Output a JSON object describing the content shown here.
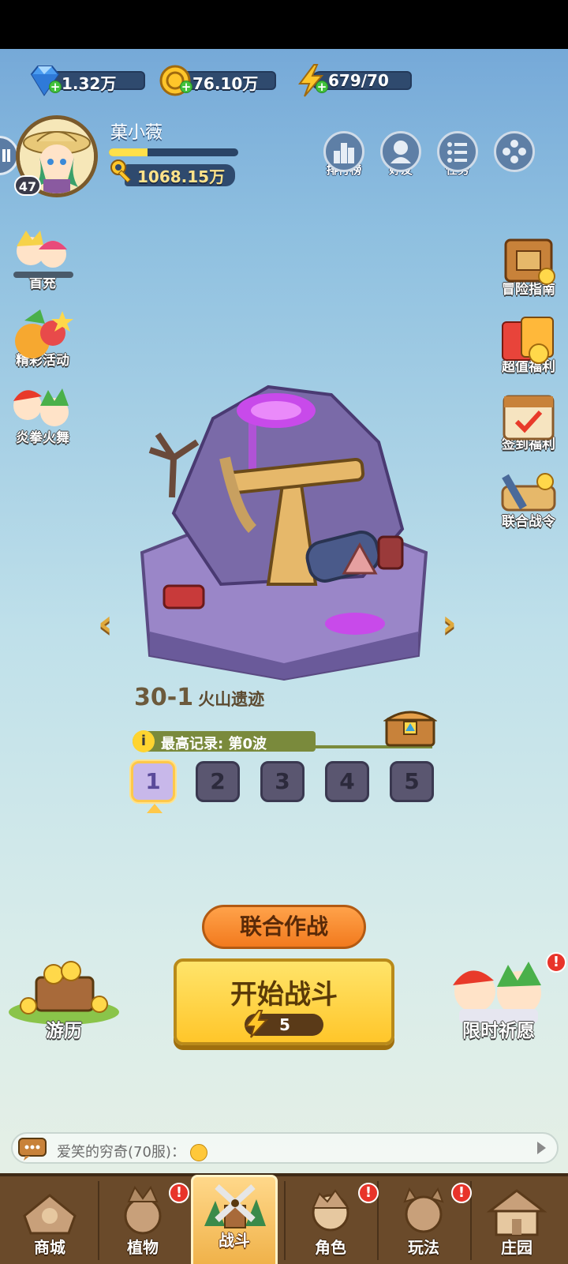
{
  "currencies": [
    {
      "name": "diamonds",
      "value": "1.32万"
    },
    {
      "name": "coins",
      "value": "76.10万"
    },
    {
      "name": "energy",
      "value": "679/70"
    }
  ],
  "player": {
    "name": "菓小薇",
    "level": "47",
    "gold": "1068.15万",
    "exp_fraction": 0.3
  },
  "top_buttons": [
    {
      "label": "排行榜",
      "icon": "ranking-icon"
    },
    {
      "label": "好友",
      "icon": "friends-icon"
    },
    {
      "label": "任务",
      "icon": "task-icon"
    },
    {
      "label": "",
      "icon": "more-icon"
    }
  ],
  "left_events": [
    {
      "label": "首充"
    },
    {
      "label": "精彩活动"
    },
    {
      "label": "炎拳火舞"
    }
  ],
  "right_events": [
    {
      "label": "冒险指南"
    },
    {
      "label": "超值福利"
    },
    {
      "label": "签到福利"
    },
    {
      "label": "联合战令"
    }
  ],
  "stage": {
    "number": "30-1",
    "name": "火山遗迹",
    "record": "最高记录: 第0波",
    "waves": [
      "1",
      "2",
      "3",
      "4",
      "5"
    ],
    "selected_wave": "1"
  },
  "actions": {
    "coop": "联合作战",
    "start": "开始战斗",
    "start_cost": "5",
    "travel": "游历",
    "wish": "限时祈愿"
  },
  "chat": {
    "text": "爱笑的穷奇(70服)："
  },
  "nav": [
    {
      "label": "商城",
      "badge": false
    },
    {
      "label": "植物",
      "badge": true
    },
    {
      "label": "战斗",
      "badge": false,
      "active": true
    },
    {
      "label": "角色",
      "badge": true
    },
    {
      "label": "玩法",
      "badge": true
    },
    {
      "label": "庄园",
      "badge": false
    }
  ],
  "badge_mark": "!",
  "colors": {
    "accent": "#ffc62a",
    "coop": "#f27a1e",
    "badge": "#e8342a",
    "nav_bg": "#6a4a2a"
  }
}
